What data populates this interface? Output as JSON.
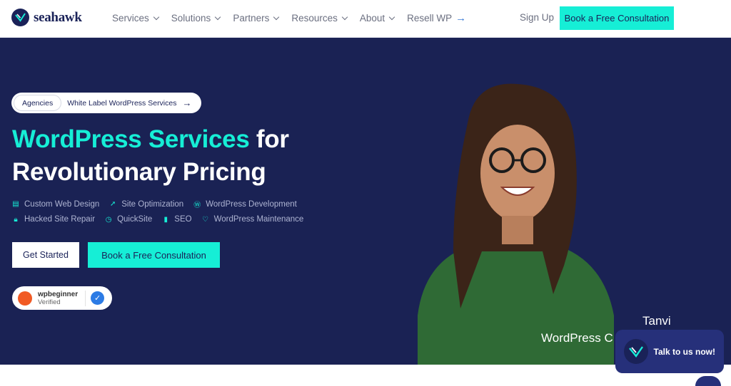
{
  "brand": {
    "name": "seahawk"
  },
  "nav": {
    "items": [
      {
        "label": "Services",
        "has_dropdown": true
      },
      {
        "label": "Solutions",
        "has_dropdown": true
      },
      {
        "label": "Partners",
        "has_dropdown": true
      },
      {
        "label": "Resources",
        "has_dropdown": true
      },
      {
        "label": "About",
        "has_dropdown": true
      },
      {
        "label": "Resell WP",
        "has_dropdown": false,
        "icon": "arrow-right-icon"
      }
    ],
    "sign_up": "Sign Up",
    "cta": "Book a Free Consultation"
  },
  "hero": {
    "pill_tag": "Agencies",
    "pill_text": "White Label WordPress Services",
    "headline_accent": "WordPress Services",
    "headline_rest_1": "for",
    "headline_line_2": "Revolutionary Pricing",
    "features": [
      {
        "label": "Custom Web Design",
        "icon": "layout-icon"
      },
      {
        "label": "Site Optimization",
        "icon": "rocket-icon"
      },
      {
        "label": "WordPress Development",
        "icon": "wordpress-icon"
      },
      {
        "label": "Hacked Site Repair",
        "icon": "lock-icon"
      },
      {
        "label": "QuickSite",
        "icon": "clock-icon"
      },
      {
        "label": "SEO",
        "icon": "bar-chart-icon"
      },
      {
        "label": "WordPress Maintenance",
        "icon": "heart-icon"
      }
    ],
    "primary_button": "Get Started",
    "secondary_button": "Book a Free Consultation",
    "badge": {
      "name": "wpbeginner",
      "status": "Verified"
    },
    "caption": {
      "name": "Tanvi",
      "role": "WordPress C"
    }
  },
  "chat": {
    "label": "Talk to us now!"
  },
  "colors": {
    "navy": "#1a2254",
    "accent": "#16eed6",
    "brand_text": "#1a2258"
  }
}
